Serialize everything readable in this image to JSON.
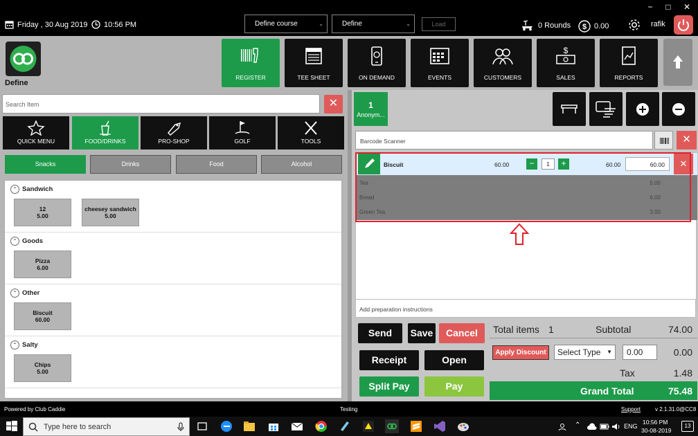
{
  "window": {
    "minimize": "−",
    "restore": "□",
    "close": "✕"
  },
  "header": {
    "date": "Friday ,  30 Aug 2019",
    "time": "10:56 PM",
    "course_select": "Define course",
    "define_select": "Define",
    "load_label": "Load",
    "rounds": "0 Rounds",
    "balance": "0.00",
    "user": "rafik"
  },
  "nav": {
    "brand_label": "Define",
    "tiles": [
      {
        "label": "REGISTER",
        "icon": "barcode-scanner-icon"
      },
      {
        "label": "TEE SHEET",
        "icon": "calendar-icon"
      },
      {
        "label": "ON DEMAND",
        "icon": "mobile-phone-icon"
      },
      {
        "label": "EVENTS",
        "icon": "events-calendar-icon"
      },
      {
        "label": "CUSTOMERS",
        "icon": "people-icon"
      },
      {
        "label": "SALES",
        "icon": "cash-icon"
      },
      {
        "label": "REPORTS",
        "icon": "report-icon"
      }
    ]
  },
  "left": {
    "search_placeholder": "Search Item",
    "categories": [
      {
        "label": "QUICK MENU",
        "icon": "star-icon"
      },
      {
        "label": "FOOD/DRINKS",
        "icon": "drink-icon"
      },
      {
        "label": "PRO-SHOP",
        "icon": "tag-icon"
      },
      {
        "label": "GOLF",
        "icon": "golf-icon"
      },
      {
        "label": "TOOLS",
        "icon": "tools-icon"
      }
    ],
    "subtabs": [
      "Snacks",
      "Drinks",
      "Food",
      "Alcohol"
    ],
    "groups": [
      {
        "name": "Sandwich",
        "items": [
          {
            "name": "12",
            "price": "5.00"
          },
          {
            "name": "cheesey sandwich",
            "price": "5.00"
          }
        ]
      },
      {
        "name": "Goods",
        "items": [
          {
            "name": "Pizza",
            "price": "6.00"
          }
        ]
      },
      {
        "name": "Other",
        "items": [
          {
            "name": "Biscuit",
            "price": "60.00"
          }
        ]
      },
      {
        "name": "Salty",
        "items": [
          {
            "name": "Chips",
            "price": "5.00"
          }
        ]
      }
    ]
  },
  "right": {
    "customer_count": "1",
    "customer_name": "Anonym...",
    "barcode_placeholder": "Barcode Scanner",
    "selected_line": {
      "name": "Biscuit",
      "unit_price": "60.00",
      "qty": "1",
      "line_total": "60.00",
      "price_field": "60.00"
    },
    "dim_lines": [
      {
        "name": "Tea",
        "price": "5.00"
      },
      {
        "name": "Bread",
        "price": "6.00"
      },
      {
        "name": "Green Tea",
        "price": "3.00"
      }
    ],
    "prep_placeholder": "Add preparation instructions",
    "buttons": {
      "send": "Send",
      "save": "Save",
      "cancel": "Cancel",
      "receipt": "Receipt",
      "open": "Open",
      "split_pay": "Split Pay",
      "pay": "Pay"
    },
    "totals": {
      "total_items_label": "Total items",
      "total_items": "1",
      "subtotal_label": "Subtotal",
      "subtotal": "74.00",
      "apply_discount": "Apply Discount",
      "select_type": "Select Type",
      "discount_value": "0.00",
      "discount_amount": "0.00",
      "tax_label": "Tax",
      "tax": "1.48",
      "grand_total_label": "Grand Total",
      "grand_total": "75.48"
    }
  },
  "footer": {
    "powered_by": "Powered by Club Caddie",
    "mode": "Testing",
    "support": "Support",
    "version": "v 2.1.31.0@CC8"
  },
  "taskbar": {
    "search_placeholder": "Type here to search",
    "lang": "ENG",
    "clock_time": "10:56 PM",
    "clock_date": "30-08-2019",
    "notifications": "13"
  },
  "colors": {
    "green": "#1d9b4b",
    "red": "#e05a5a",
    "dark": "#111111",
    "panel_gray": "#b5b5b5"
  }
}
